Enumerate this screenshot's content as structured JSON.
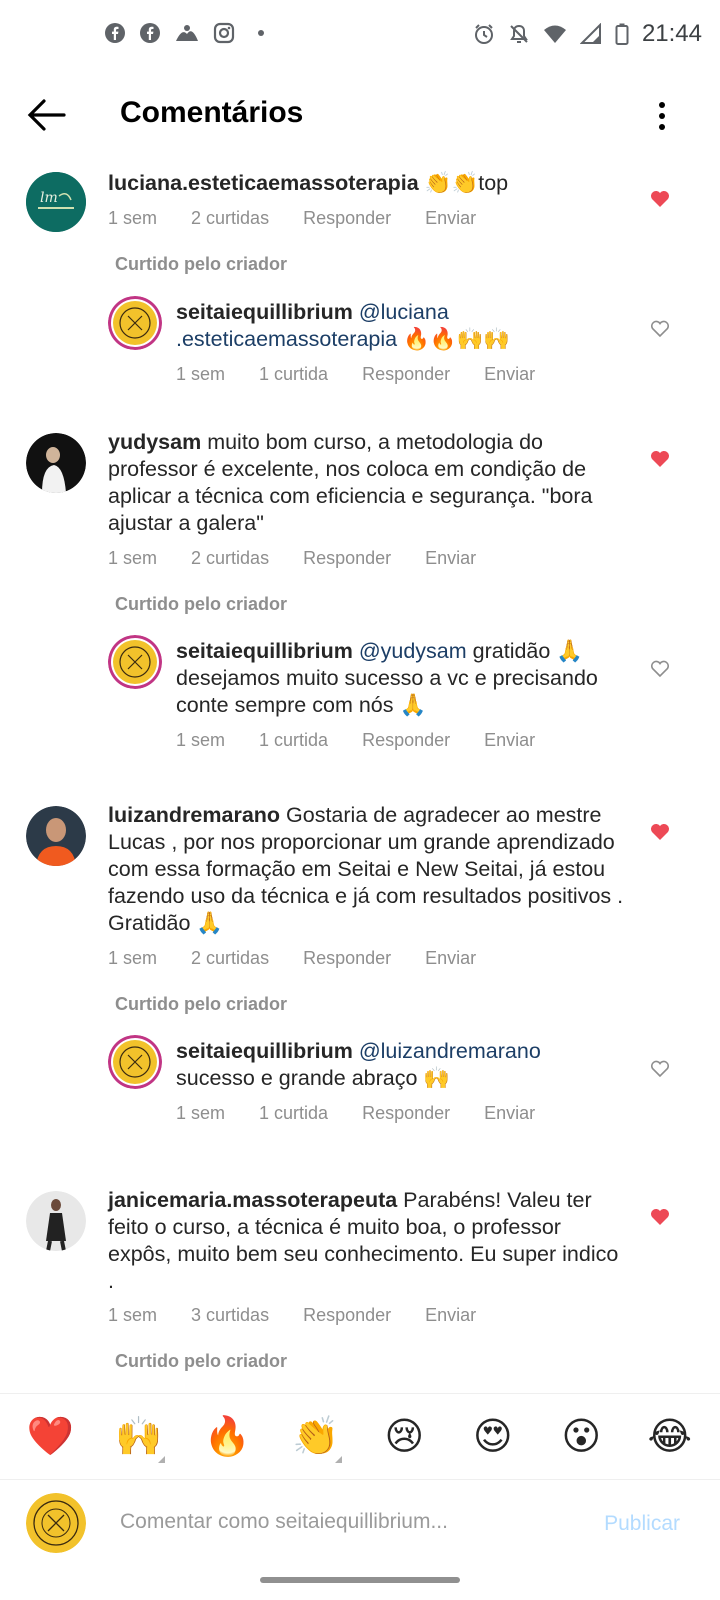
{
  "status_bar": {
    "time": "21:44",
    "left_icons": [
      "facebook-icon",
      "facebook-icon",
      "app-icon",
      "instagram-icon"
    ],
    "right_icons": [
      "alarm-icon",
      "mute-icon",
      "wifi-icon",
      "signal-icon",
      "battery-icon"
    ]
  },
  "header": {
    "title": "Comentários"
  },
  "liked_label": "Curtido pelo criador",
  "comments": [
    {
      "user": "luciana.esteticaemassoterapia",
      "text": " 👏👏top",
      "time": "1 sem",
      "likes": "2 curtidas",
      "reply": "Responder",
      "send": "Enviar",
      "liked": true,
      "liked_by_creator": "Curtido pelo criador",
      "response": {
        "user": "seitaiequillibrium",
        "mention": "@luciana .esteticaemassoterapia",
        "text": " 🔥🔥🙌🙌",
        "time": "1 sem",
        "likes": "1 curtida",
        "reply": "Responder",
        "send": "Enviar"
      }
    },
    {
      "user": "yudysam",
      "text": " muito bom curso, a metodologia do professor é excelente, nos coloca em condição de aplicar a técnica com eficiencia  e segurança. \"bora ajustar a galera\"",
      "time": "1 sem",
      "likes": "2 curtidas",
      "reply": "Responder",
      "send": "Enviar",
      "liked": true,
      "liked_by_creator": "Curtido pelo criador",
      "response": {
        "user": "seitaiequillibrium",
        "mention": "@yudysam",
        "text": " gratidão 🙏 desejamos muito sucesso a vc e precisando conte sempre com nós 🙏",
        "time": "1 sem",
        "likes": "1 curtida",
        "reply": "Responder",
        "send": "Enviar"
      }
    },
    {
      "user": "luizandremarano",
      "text": " Gostaria de agradecer ao mestre Lucas , por nos proporcionar um grande aprendizado com essa formação em Seitai e New Seitai, já estou fazendo uso da técnica e já com resultados positivos . Gratidão 🙏",
      "time": "1 sem",
      "likes": "2 curtidas",
      "reply": "Responder",
      "send": "Enviar",
      "liked": true,
      "liked_by_creator": "Curtido pelo criador",
      "response": {
        "user": "seitaiequillibrium",
        "mention": "@luizandremarano",
        "text": " sucesso e grande abraço 🙌",
        "time": "1 sem",
        "likes": "1 curtida",
        "reply": "Responder",
        "send": "Enviar"
      }
    },
    {
      "user": "janicemaria.massoterapeuta",
      "text": " Parabéns! Valeu ter feito o curso, a técnica é muito boa, o professor expôs,  muito bem seu conhecimento. Eu super indico .",
      "time": "1 sem",
      "likes": "3 curtidas",
      "reply": "Responder",
      "send": "Enviar",
      "liked": true,
      "liked_by_creator": "Curtido pelo criador"
    }
  ],
  "reactions": [
    "❤️",
    "🙌",
    "🔥",
    "👏",
    "😢",
    "😍",
    "😮",
    "😂"
  ],
  "composer": {
    "placeholder": "Comentar como seitaiequillibrium...",
    "publish_label": "Publicar"
  },
  "colors": {
    "heart_liked": "#ed4956",
    "link": "#1c3e66",
    "muted": "#8e8e8e",
    "publish": "#b3dbff"
  }
}
